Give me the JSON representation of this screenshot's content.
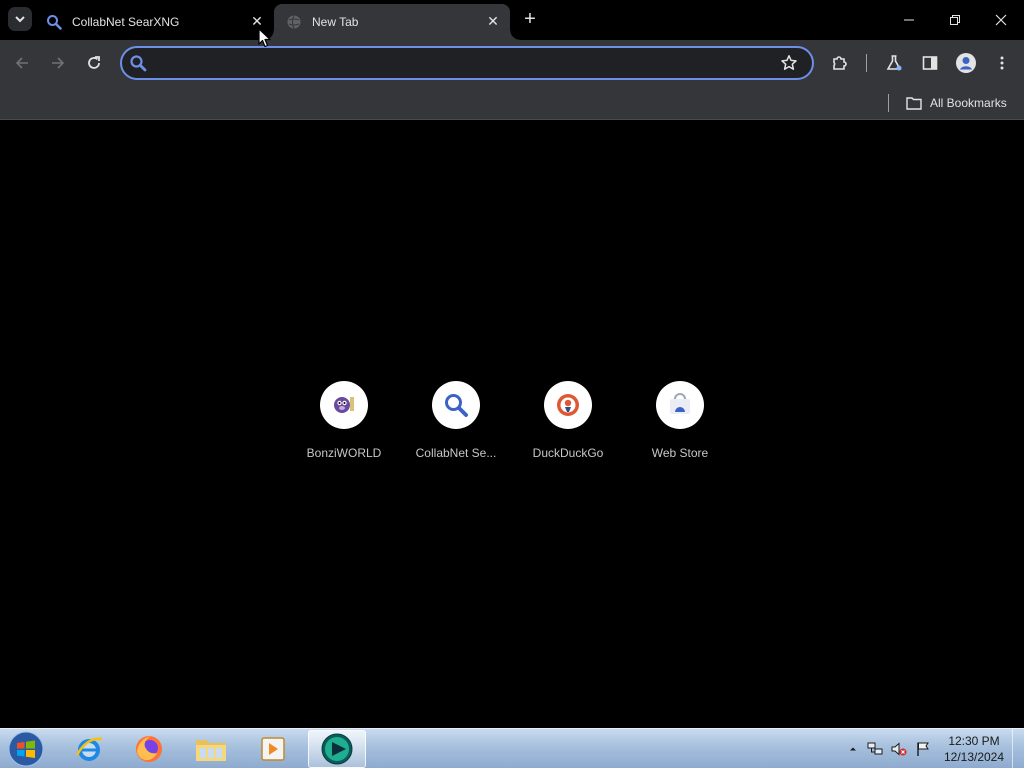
{
  "tabs": [
    {
      "title": "CollabNet SearXNG",
      "favicon": "search-icon",
      "active": false
    },
    {
      "title": "New Tab",
      "favicon": "globe-icon",
      "active": true
    }
  ],
  "toolbar": {
    "omnibox_value": "",
    "accent": "#6d8fe8"
  },
  "bookmarks": {
    "all_bookmarks_label": "All Bookmarks"
  },
  "shortcuts": [
    {
      "label": "BonziWORLD",
      "icon": "bonzi-icon"
    },
    {
      "label": "CollabNet Se...",
      "icon": "search-icon"
    },
    {
      "label": "DuckDuckGo",
      "icon": "duckduckgo-icon"
    },
    {
      "label": "Web Store",
      "icon": "webstore-icon"
    }
  ],
  "taskbar": {
    "apps": [
      "internet-explorer",
      "firefox",
      "file-explorer",
      "media-player",
      "chromium"
    ],
    "time": "12:30 PM",
    "date": "12/13/2024"
  }
}
